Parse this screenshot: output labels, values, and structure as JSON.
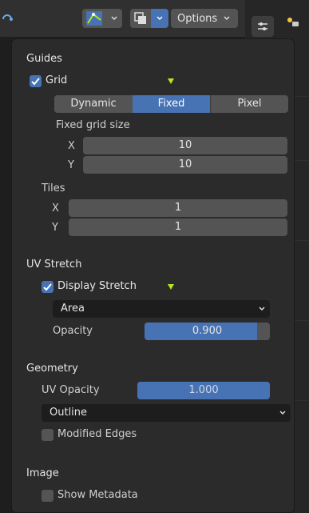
{
  "toolbar": {
    "options_label": "Options"
  },
  "panel": {
    "guides": {
      "heading": "Guides",
      "grid_label": "Grid",
      "grid_checked": true,
      "grid_modes": [
        "Dynamic",
        "Fixed",
        "Pixel"
      ],
      "selected_mode": "Fixed",
      "fixed_grid_size_label": "Fixed grid size",
      "x_label": "X",
      "x_value": "10",
      "y_label": "Y",
      "y_value": "10",
      "tiles_label": "Tiles",
      "tiles_x_label": "X",
      "tiles_x_value": "1",
      "tiles_y_label": "Y",
      "tiles_y_value": "1"
    },
    "uv_stretch": {
      "heading": "UV Stretch",
      "display_stretch_label": "Display Stretch",
      "display_stretch_checked": true,
      "stretch_type": "Area",
      "opacity_label": "Opacity",
      "opacity_value": "0.900",
      "opacity_fraction": 0.9
    },
    "geometry": {
      "heading": "Geometry",
      "uv_opacity_label": "UV Opacity",
      "uv_opacity_value": "1.000",
      "uv_opacity_fraction": 1.0,
      "edge_display": "Outline",
      "modified_edges_label": "Modified Edges",
      "modified_edges_checked": false
    },
    "image": {
      "heading": "Image",
      "show_metadata_label": "Show Metadata",
      "show_metadata_checked": false
    }
  },
  "colors": {
    "accent": "#4772b3",
    "widget": "#545454",
    "panel_bg": "#2b2b2b",
    "overlay_green": "#b5e61d"
  },
  "icons": [
    "sync-icon",
    "uv-select-mode-icon",
    "overlay-icon",
    "chevron-down-icon",
    "properties-icon",
    "checkmark-icon"
  ]
}
